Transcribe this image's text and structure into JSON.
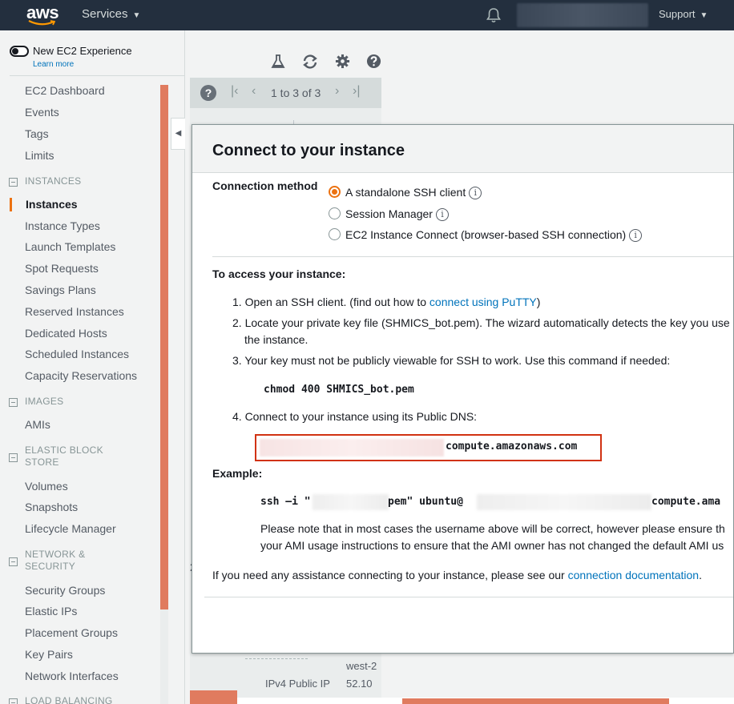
{
  "topnav": {
    "logo": "aws",
    "services_label": "Services",
    "support_label": "Support",
    "icons": [
      "bell-icon",
      "caret-down-icon"
    ]
  },
  "sidebar": {
    "toggle_label": "New EC2 Experience",
    "learn_more": "Learn more",
    "items_top": [
      "EC2 Dashboard",
      "Events",
      "Tags",
      "Limits"
    ],
    "section_instances": "INSTANCES",
    "items_instances": [
      "Instances",
      "Instance Types",
      "Launch Templates",
      "Spot Requests",
      "Savings Plans",
      "Reserved Instances",
      "Dedicated Hosts",
      "Scheduled Instances",
      "Capacity Reservations"
    ],
    "section_images": "IMAGES",
    "items_images": [
      "AMIs"
    ],
    "section_ebs_1": "ELASTIC BLOCK",
    "section_ebs_2": "STORE",
    "items_ebs": [
      "Volumes",
      "Snapshots",
      "Lifecycle Manager"
    ],
    "section_net_1": "NETWORK &",
    "section_net_2": "SECURITY",
    "items_net": [
      "Security Groups",
      "Elastic IPs",
      "Placement Groups",
      "Key Pairs",
      "Network Interfaces"
    ],
    "section_lb": "LOAD BALANCING",
    "active_item": "Instances",
    "accent_color": "#ec7211"
  },
  "main": {
    "pagination_text": "1 to 3 of 3",
    "behind_label": "IPv4 Public IP",
    "behind_value": "52.10",
    "behind_value2": "west-2",
    "behind_char": "2"
  },
  "modal": {
    "title": "Connect to your instance",
    "connection_method_label": "Connection method",
    "options": [
      "A standalone SSH client",
      "Session Manager",
      "EC2 Instance Connect (browser-based SSH connection)"
    ],
    "selected_option": "A standalone SSH client",
    "access_heading": "To access your instance:",
    "step1_pre": "1. Open an SSH client. (find out how to ",
    "step1_link": "connect using PuTTY",
    "step1_post": ")",
    "step2_line1": "2. Locate your private key file (SHMICS_bot.pem). The wizard automatically detects the key you use",
    "step2_line2": "the instance.",
    "step3": "3. Your key must not be publicly viewable for SSH to work. Use this command if needed:",
    "chmod_command": "chmod 400 SHMICS_bot.pem",
    "step4": "4. Connect to your instance using its Public DNS:",
    "dns_suffix": "compute.amazonaws.com",
    "example_label": "Example:",
    "ex_part1": "ssh –i \"",
    "ex_part2": "pem\" ubuntu@",
    "ex_part3": "compute.ama",
    "note_line1": "Please note that in most cases the username above will be correct, however please ensure th",
    "note_line2": "your AMI usage instructions to ensure that the AMI owner has not changed the default AMI us",
    "help_pre": "If you need any assistance connecting to your instance, please see our ",
    "help_link": "connection documentation",
    "help_post": ".",
    "link_color": "#0073bb",
    "highlight_color": "#d13212"
  }
}
